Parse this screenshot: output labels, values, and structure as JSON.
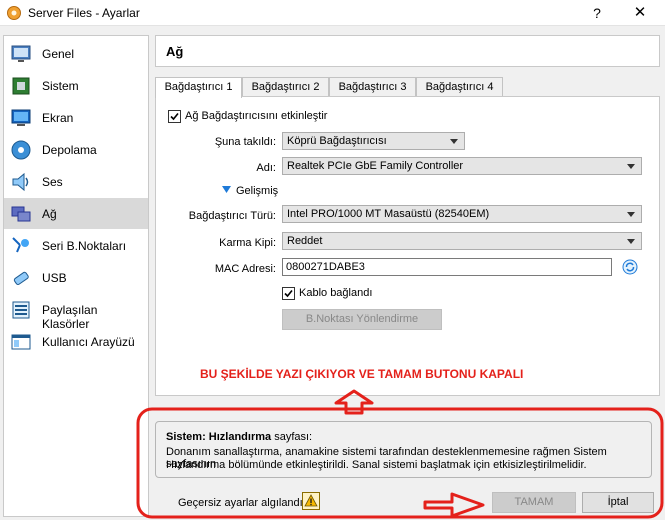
{
  "window": {
    "title": "Server Files - Ayarlar",
    "help": "?",
    "close": "✕"
  },
  "sidebar": {
    "items": [
      {
        "label": "Genel",
        "icon": "general-icon"
      },
      {
        "label": "Sistem",
        "icon": "system-icon"
      },
      {
        "label": "Ekran",
        "icon": "display-icon"
      },
      {
        "label": "Depolama",
        "icon": "storage-icon"
      },
      {
        "label": "Ses",
        "icon": "audio-icon"
      },
      {
        "label": "Ağ",
        "icon": "network-icon"
      },
      {
        "label": "Seri B.Noktaları",
        "icon": "serial-port-icon"
      },
      {
        "label": "USB",
        "icon": "usb-icon"
      },
      {
        "label": "Paylaşılan Klasörler",
        "icon": "shared-folder-icon"
      },
      {
        "label": "Kullanıcı Arayüzü",
        "icon": "user-interface-icon"
      }
    ],
    "selected": "Ağ"
  },
  "header": {
    "title": "Ağ"
  },
  "tabs": [
    "Bağdaştırıcı 1",
    "Bağdaştırıcı 2",
    "Bağdaştırıcı 3",
    "Bağdaştırıcı 4"
  ],
  "form": {
    "enable_label": "Ağ Bağdaştırıcısını etkinleştir",
    "attached_label": "Şuna takıldı:",
    "attached_value": "Köprü Bağdaştırıcısı",
    "name_label": "Adı:",
    "name_value": "Realtek PCIe GbE Family Controller",
    "advanced_label": "Gelişmiş",
    "adapter_type_label": "Bağdaştırıcı Türü:",
    "adapter_type_value": "Intel PRO/1000 MT Masaüstü (82540EM)",
    "promisc_label": "Karma Kipi:",
    "promisc_value": "Reddet",
    "mac_label": "MAC Adresi:",
    "mac_value": "0800271DABE3",
    "cable_label": "Kablo bağlandı",
    "port_forward_label": "B.Noktası Yönlendirme"
  },
  "annotation": "BU ŞEKİLDE YAZI ÇIKIYOR VE TAMAM BUTONU KAPALI",
  "info": {
    "title_bold": "Sistem: Hızlandırma",
    "title_rest": " sayfası:",
    "line1": "Donanım sanallaştırma, anamakine sistemi tarafından desteklenmemesine rağmen Sistem sayfasının",
    "line2": "Hızlandırma bölümünde etkinleştirildi. Sanal sistemi başlatmak için etkisizleştirilmelidir."
  },
  "footer": {
    "invalid_label": "Geçersiz ayarlar algılandı",
    "ok_label": "TAMAM",
    "cancel_label": "İptal"
  },
  "colors": {
    "annotation_red": "#e4211b",
    "selected_bg": "#d9d9d9",
    "accent_blue": "#1e7ad8"
  }
}
